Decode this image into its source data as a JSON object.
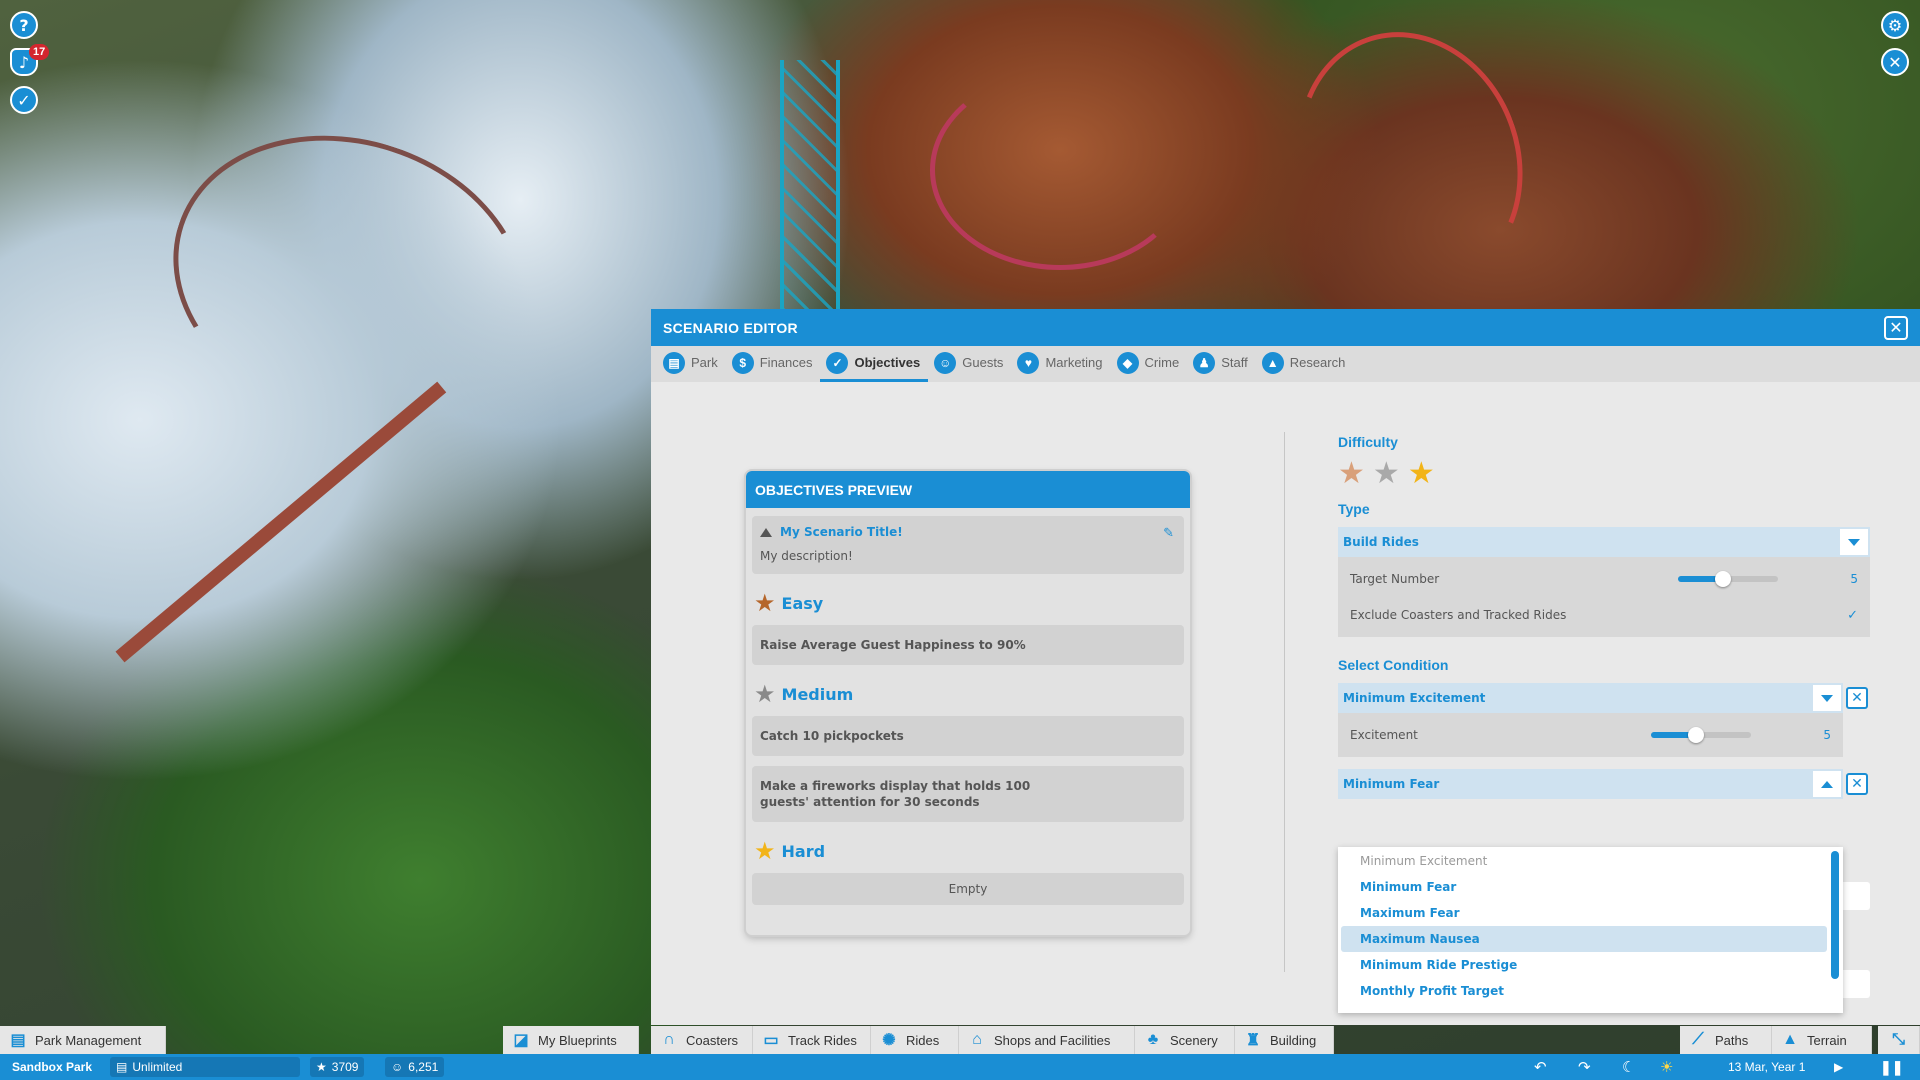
{
  "hud": {
    "help_icon": "help-icon",
    "notifications_count": "17",
    "objectives_icon": "checkmark-icon",
    "settings_icon": "gear-icon",
    "tools_icon": "wrench-screwdriver-icon"
  },
  "editor": {
    "title": "SCENARIO EDITOR",
    "close_label": "✕",
    "tabs": [
      {
        "label": "Park",
        "icon": "clipboard-icon"
      },
      {
        "label": "Finances",
        "icon": "dollar-icon"
      },
      {
        "label": "Objectives",
        "icon": "checkmark-icon",
        "active": true
      },
      {
        "label": "Guests",
        "icon": "people-icon"
      },
      {
        "label": "Marketing",
        "icon": "thumbs-up-icon"
      },
      {
        "label": "Crime",
        "icon": "shield-icon"
      },
      {
        "label": "Staff",
        "icon": "staff-icon"
      },
      {
        "label": "Research",
        "icon": "flask-icon"
      }
    ]
  },
  "preview": {
    "header": "OBJECTIVES PREVIEW",
    "scenario_title": "My Scenario Title!",
    "scenario_description": "My description!",
    "levels": [
      {
        "name": "Easy",
        "star_color": "#b5662b",
        "objectives": [
          "Raise Average Guest Happiness to 90%"
        ]
      },
      {
        "name": "Medium",
        "star_color": "#8a8a8a",
        "objectives": [
          "Catch 10 pickpockets",
          "Make a fireworks display that holds 100 guests' attention for 30 seconds"
        ]
      },
      {
        "name": "Hard",
        "star_color": "#f2b418",
        "objectives": [],
        "empty_label": "Empty"
      }
    ]
  },
  "settings": {
    "difficulty": {
      "label": "Difficulty",
      "stars": [
        {
          "level": "easy",
          "color": "#d9a07a"
        },
        {
          "level": "medium",
          "color": "#a9a9a9"
        },
        {
          "level": "hard",
          "color": "#f2b418",
          "selected": true
        }
      ]
    },
    "type": {
      "label": "Type",
      "selected": "Build Rides",
      "target_number_label": "Target Number",
      "target_number_value": "5",
      "target_number_fraction": 0.45,
      "exclude_label": "Exclude Coasters and Tracked Rides",
      "exclude_checked": true
    },
    "condition": {
      "label": "Select Condition",
      "condition1_selected": "Minimum Excitement",
      "excitement_label": "Excitement",
      "excitement_value": "5",
      "excitement_fraction": 0.45,
      "condition2_selected": "Minimum Fear",
      "options": [
        {
          "label": "Minimum Excitement",
          "disabled": true
        },
        {
          "label": "Minimum Fear"
        },
        {
          "label": "Maximum Fear"
        },
        {
          "label": "Maximum Nausea",
          "hover": true
        },
        {
          "label": "Minimum Ride Prestige"
        },
        {
          "label": "Monthly Profit Target"
        }
      ]
    }
  },
  "build_toolbar": {
    "park_management": "Park Management",
    "my_blueprints": "My Blueprints",
    "coasters": "Coasters",
    "track_rides": "Track Rides",
    "rides": "Rides",
    "shops": "Shops and Facilities",
    "scenery": "Scenery",
    "building": "Building",
    "paths": "Paths",
    "terrain": "Terrain"
  },
  "status": {
    "park_name": "Sandbox Park",
    "money": "Unlimited",
    "rating": "3709",
    "guests": "6,251",
    "date": "13 Mar, Year 1"
  },
  "colors": {
    "accent": "#1a8ed4",
    "panel": "#e9e9e9"
  }
}
